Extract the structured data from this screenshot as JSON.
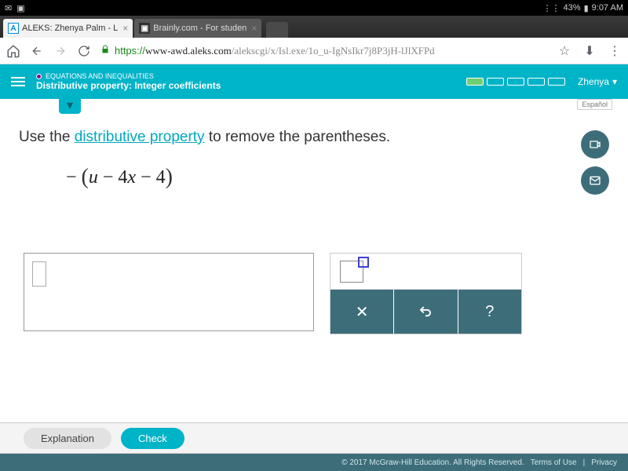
{
  "status": {
    "battery": "43%",
    "time": "9:07 AM"
  },
  "tabs": [
    {
      "favicon": "A",
      "title": "ALEKS: Zhenya Palm - L"
    },
    {
      "favicon": "B",
      "title": "Brainly.com - For studen"
    }
  ],
  "url": {
    "proto": "https://",
    "domain": "www-awd.aleks.com",
    "path": "/alekscgi/x/Isl.exe/1o_u-IgNsIkr7j8P3jH-lJlXFPd"
  },
  "header": {
    "category": "EQUATIONS AND INEQUALITIES",
    "topic": "Distributive property: Integer coefficients",
    "user": "Zhenya"
  },
  "espanol": "Español",
  "question": {
    "pre": "Use the ",
    "link": "distributive property",
    "post": " to remove the parentheses."
  },
  "expression": "− (u − 4x − 4)",
  "keypad": {
    "multiply": "✕",
    "undo": "↶",
    "help": "?"
  },
  "actions": {
    "explain": "Explanation",
    "check": "Check"
  },
  "footer": {
    "copyright": "© 2017 McGraw-Hill Education. All Rights Reserved.",
    "terms": "Terms of Use",
    "privacy": "Privacy"
  }
}
